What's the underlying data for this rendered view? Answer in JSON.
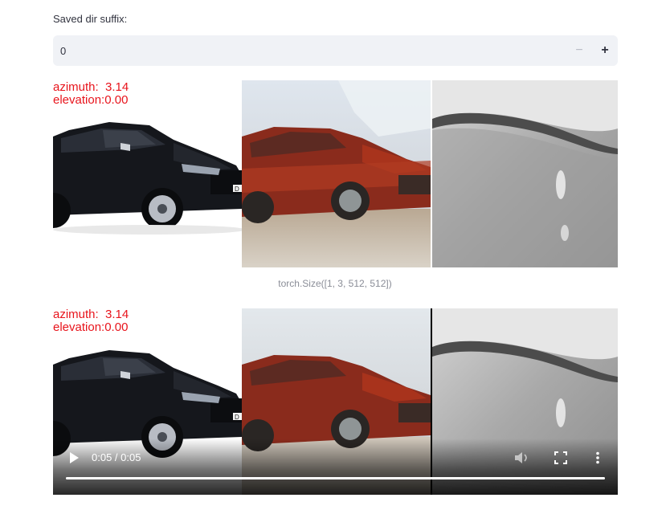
{
  "input": {
    "label": "Saved dir suffix:",
    "value": "0",
    "minus_label": "−",
    "plus_label": "+"
  },
  "strip_top": {
    "azimuth_text": "azimuth:  3.14",
    "elevation_text": "elevation:0.00",
    "plate_text": "D"
  },
  "caption": "torch.Size([1, 3, 512, 512])",
  "strip_bottom": {
    "azimuth_text": "azimuth:  3.14",
    "elevation_text": "elevation:0.00",
    "plate_text": "D"
  },
  "video": {
    "time_display": "0:05 / 0:05",
    "progress": 1.0,
    "controls": [
      "play-icon",
      "volume-icon",
      "fullscreen-icon",
      "more-options-icon"
    ]
  },
  "colors": {
    "overlay_text": "#e8141c",
    "input_bg": "#f0f2f6",
    "caption": "#8a8d97"
  }
}
